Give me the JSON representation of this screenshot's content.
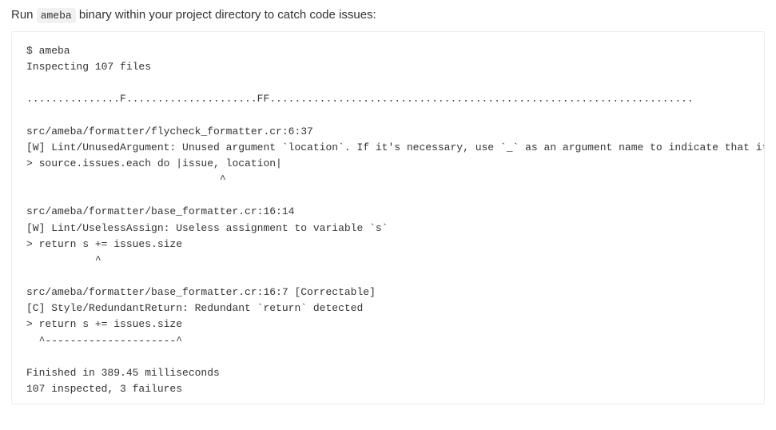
{
  "intro": {
    "prefix": "Run ",
    "code": "ameba",
    "suffix": " binary within your project directory to catch code issues:"
  },
  "terminal": {
    "lines": [
      "$ ameba",
      "Inspecting 107 files",
      "",
      "...............F.....................FF....................................................................",
      "",
      "src/ameba/formatter/flycheck_formatter.cr:6:37",
      "[W] Lint/UnusedArgument: Unused argument `location`. If it's necessary, use `_` as an argument name to indicate that it won't be used.",
      "> source.issues.each do |issue, location|",
      "                               ^",
      "",
      "src/ameba/formatter/base_formatter.cr:16:14",
      "[W] Lint/UselessAssign: Useless assignment to variable `s`",
      "> return s += issues.size",
      "           ^",
      "",
      "src/ameba/formatter/base_formatter.cr:16:7 [Correctable]",
      "[C] Style/RedundantReturn: Redundant `return` detected",
      "> return s += issues.size",
      "  ^---------------------^",
      "",
      "Finished in 389.45 milliseconds",
      "107 inspected, 3 failures"
    ]
  }
}
